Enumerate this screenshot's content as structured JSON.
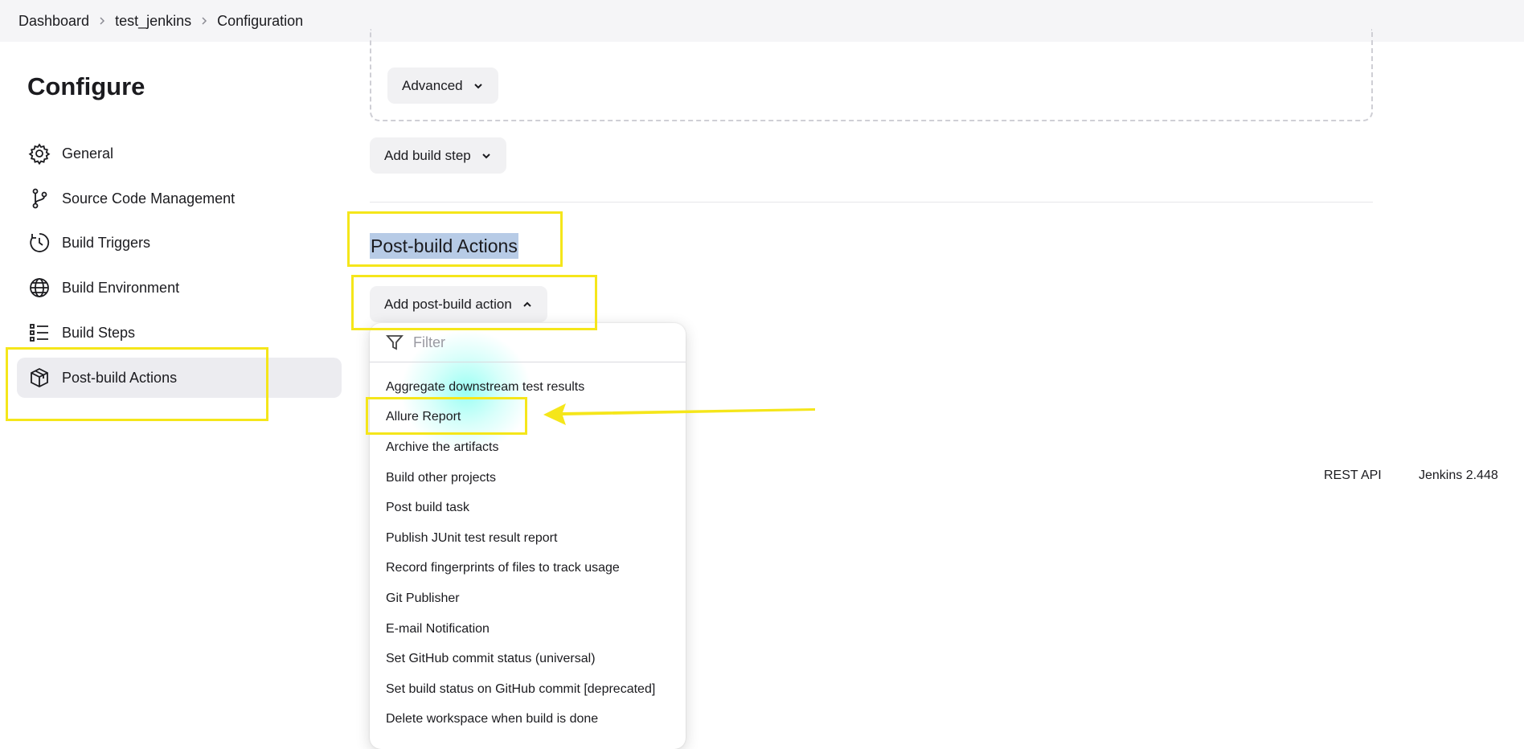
{
  "breadcrumb": [
    "Dashboard",
    "test_jenkins",
    "Configuration"
  ],
  "sidebar": {
    "title": "Configure",
    "items": [
      {
        "label": "General",
        "icon": "gear-icon"
      },
      {
        "label": "Source Code Management",
        "icon": "branch-icon"
      },
      {
        "label": "Build Triggers",
        "icon": "clock-icon"
      },
      {
        "label": "Build Environment",
        "icon": "globe-icon"
      },
      {
        "label": "Build Steps",
        "icon": "list-icon"
      },
      {
        "label": "Post-build Actions",
        "icon": "package-icon",
        "active": true
      }
    ]
  },
  "main": {
    "advanced_label": "Advanced",
    "add_build_step_label": "Add build step",
    "post_build_title": "Post-build Actions",
    "add_post_build_label": "Add post-build action"
  },
  "dropdown": {
    "filter_placeholder": "Filter",
    "items": [
      "Aggregate downstream test results",
      "Allure Report",
      "Archive the artifacts",
      "Build other projects",
      "Post build task",
      "Publish JUnit test result report",
      "Record fingerprints of files to track usage",
      "Git Publisher",
      "E-mail Notification",
      "Set GitHub commit status (universal)",
      "Set build status on GitHub commit [deprecated]",
      "Delete workspace when build is done"
    ]
  },
  "footer": {
    "rest_api": "REST API",
    "version": "Jenkins 2.448"
  },
  "colors": {
    "highlight": "#f5e61a",
    "selection": "#b7cbe6",
    "active_bg": "#ececf0"
  }
}
